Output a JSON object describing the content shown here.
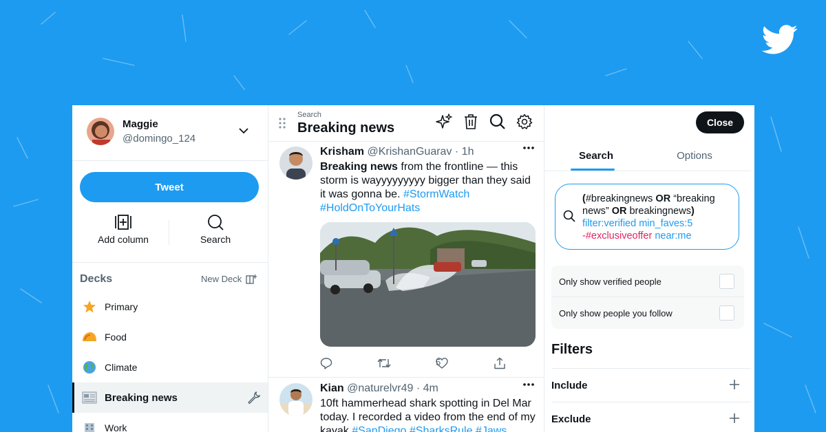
{
  "colors": {
    "brand": "#1d9bf0",
    "text": "#0f1419",
    "muted": "#536471",
    "negative_filter": "#e0245e"
  },
  "brand_logo": "twitter-bird",
  "profile": {
    "name": "Maggie",
    "handle": "@domingo_124"
  },
  "tweet_button": "Tweet",
  "quick_actions": {
    "add_column": "Add column",
    "search": "Search"
  },
  "decks": {
    "title": "Decks",
    "new_deck": "New Deck",
    "items": [
      {
        "label": "Primary",
        "icon": "star-icon"
      },
      {
        "label": "Food",
        "icon": "taco-icon"
      },
      {
        "label": "Climate",
        "icon": "globe-icon"
      },
      {
        "label": "Breaking news",
        "icon": "newspaper-icon",
        "active": true
      },
      {
        "label": "Work",
        "icon": "building-icon"
      }
    ]
  },
  "column": {
    "kicker": "Search",
    "title": "Breaking news"
  },
  "tweets": [
    {
      "name": "Krisham",
      "handle": "@KrishanGuarav",
      "time": "· 1h",
      "bold_lead": "Breaking news",
      "text": " from the frontline — this storm is wayyyyyyyyy bigger than they said it was gonna be. ",
      "hashtags": "#StormWatch #HoldOnToYourHats",
      "media": "car-splashing-through-flooded-street-photo",
      "likes": "5"
    },
    {
      "name": "Kian",
      "handle": "@naturelvr49",
      "time": "· 4m",
      "text": "10ft hammerhead shark spotting in Del Mar today. I recorded a video from the end of my kayak ",
      "hashtags": "#SanDiego #SharksRule #Jaws"
    }
  ],
  "panel": {
    "close": "Close",
    "tabs": [
      "Search",
      "Options"
    ],
    "query": {
      "open_paren": "(",
      "t1": "#breakingnews ",
      "or1": "OR",
      "t2": " “breaking news” ",
      "or2": "OR",
      "t3": " breakingnews",
      "close_paren": ")",
      "filters": "filter:verified min_faves:5",
      "excluded": "-#exclusiveoffer",
      "near": "near:me"
    },
    "checkboxes": [
      "Only show verified people",
      "Only show people you follow"
    ],
    "filters_title": "Filters",
    "filter_rows": [
      "Include",
      "Exclude"
    ]
  }
}
